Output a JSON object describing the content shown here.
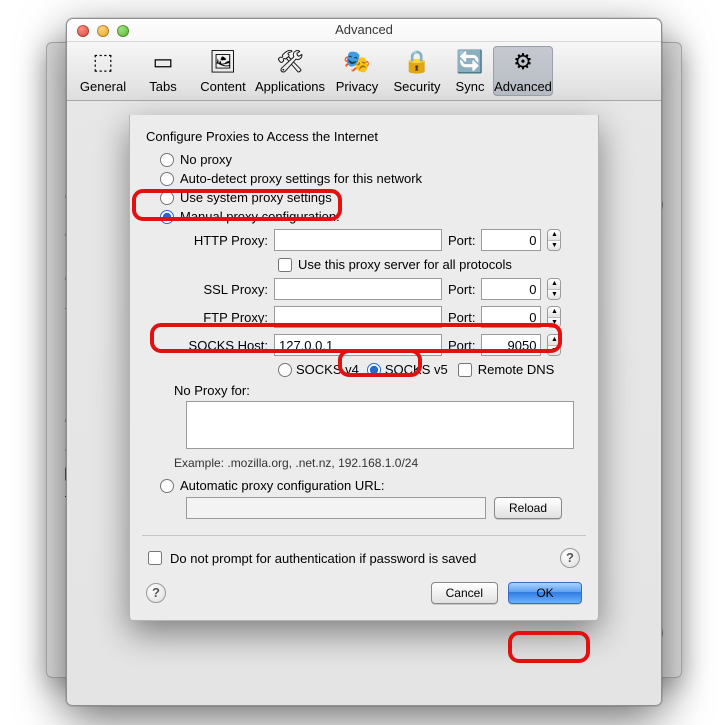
{
  "window": {
    "title": "Advanced"
  },
  "toolbar": {
    "items": [
      {
        "label": "General",
        "icon": "⎈"
      },
      {
        "label": "Tabs",
        "icon": "▭"
      },
      {
        "label": "Content",
        "icon": "🖼"
      },
      {
        "label": "Applications",
        "icon": "🛠"
      },
      {
        "label": "Privacy",
        "icon": "🎭"
      },
      {
        "label": "Security",
        "icon": "🔒"
      },
      {
        "label": "Sync",
        "icon": "🔄"
      },
      {
        "label": "Advanced",
        "icon": "⚙"
      }
    ],
    "selected_index": 7
  },
  "sheet": {
    "heading": "Configure Proxies to Access the Internet",
    "options": {
      "no_proxy": "No proxy",
      "auto_detect": "Auto-detect proxy settings for this network",
      "system": "Use system proxy settings",
      "manual": "Manual proxy configuration:",
      "pac": "Automatic proxy configuration URL:"
    },
    "selected_option": "manual",
    "fields": {
      "http": {
        "label": "HTTP Proxy:",
        "value": "",
        "port": "0"
      },
      "same_for_all": "Use this proxy server for all protocols",
      "ssl": {
        "label": "SSL Proxy:",
        "value": "",
        "port": "0"
      },
      "ftp": {
        "label": "FTP Proxy:",
        "value": "",
        "port": "0"
      },
      "socks": {
        "label": "SOCKS Host:",
        "value": "127.0.0.1",
        "port": "9050"
      },
      "port_label": "Port:",
      "socks_version": {
        "v4": "SOCKS v4",
        "v5": "SOCKS v5",
        "remote_dns": "Remote DNS",
        "selected": "v5"
      },
      "no_proxy_for": {
        "label": "No Proxy for:",
        "value": ""
      },
      "example": "Example: .mozilla.org, .net.nz, 192.168.1.0/24",
      "pac_url": "",
      "reload": "Reload"
    },
    "prompt_auth": "Do not prompt for authentication if password is saved",
    "buttons": {
      "cancel": "Cancel",
      "ok": "OK"
    }
  },
  "bg": {
    "letters": [
      "C",
      "C",
      "C",
      "Y",
      "O",
      "Y",
      "T"
    ],
    "chk_checked": true
  }
}
